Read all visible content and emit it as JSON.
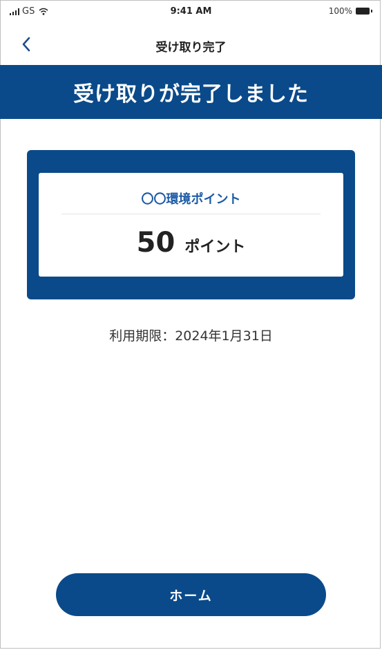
{
  "status_bar": {
    "carrier": "GS",
    "time": "9:41 AM",
    "battery": "100%"
  },
  "nav": {
    "title": "受け取り完了",
    "back_icon": "chevron-left-icon"
  },
  "banner": {
    "text": "受け取りが完了しました"
  },
  "point_card": {
    "name": "〇〇環境ポイント",
    "value": "50",
    "unit": "ポイント"
  },
  "expiry": {
    "text": "利用期限：2024年1月31日"
  },
  "home_button": {
    "label": "ホーム"
  },
  "colors": {
    "brand": "#0a4a8a",
    "point_name": "#1b5aa5"
  }
}
